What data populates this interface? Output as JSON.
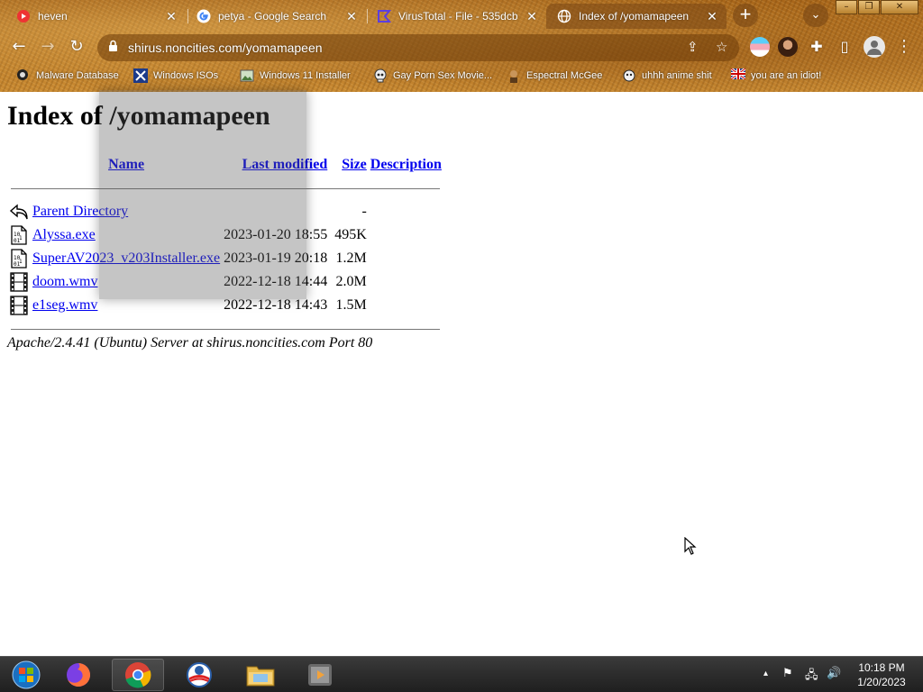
{
  "browser": {
    "tabs": [
      {
        "title": "heven",
        "icon": "youtube-red-icon",
        "active": false
      },
      {
        "title": "petya - Google Search",
        "icon": "google-g-icon",
        "active": false
      },
      {
        "title": "VirusTotal - File - 535dcb",
        "icon": "virustotal-icon",
        "active": false
      },
      {
        "title": "Index of /yomamapeen",
        "icon": "globe-icon",
        "active": true
      }
    ],
    "tab_close_glyph": "✕",
    "new_tab_glyph": "+",
    "tab_search_glyph": "⌄",
    "window_controls": {
      "minimize": "–",
      "maximize": "❐",
      "close": "✕"
    },
    "nav": {
      "back": "←",
      "forward": "→",
      "reload": "↻"
    },
    "address": {
      "url": "shirus.noncities.com/yomamapeen",
      "lock": "🔒",
      "share": "⇪",
      "star": "☆"
    },
    "toolbar_right": {
      "extensions": "✚",
      "sidepanel": "▯",
      "profile": "●",
      "menu": "⋮"
    },
    "bookmarks": [
      {
        "label": "Malware Database",
        "icon": "ball-icon"
      },
      {
        "label": "Windows ISOs",
        "icon": "x-logo-icon"
      },
      {
        "label": "Windows 11 Installer",
        "icon": "image-icon"
      },
      {
        "label": "Gay Porn Sex Movie...",
        "icon": "skull-icon"
      },
      {
        "label": "Espectral McGee",
        "icon": "character-icon"
      },
      {
        "label": "uhhh anime shit",
        "icon": "character-icon"
      },
      {
        "label": "you are an idiot!",
        "icon": "flag-icon"
      }
    ]
  },
  "page": {
    "title": "Index of /yomamapeen",
    "columns": {
      "name": "Name",
      "modified": "Last modified",
      "size": "Size",
      "description": "Description"
    },
    "rows": [
      {
        "icon": "back-arrow-icon",
        "name": "Parent Directory",
        "modified": "",
        "size": "-",
        "description": ""
      },
      {
        "icon": "binary-file-icon",
        "name": "Alyssa.exe",
        "modified": "2023-01-20 18:55",
        "size": "495K",
        "description": ""
      },
      {
        "icon": "binary-file-icon",
        "name": "SuperAV2023_v203Installer.exe",
        "modified": "2023-01-19 20:18",
        "size": "1.2M",
        "description": ""
      },
      {
        "icon": "film-icon",
        "name": "doom.wmv",
        "modified": "2022-12-18 14:44",
        "size": "2.0M",
        "description": ""
      },
      {
        "icon": "film-icon",
        "name": "e1seg.wmv",
        "modified": "2022-12-18 14:43",
        "size": "1.5M",
        "description": ""
      }
    ],
    "footer": "Apache/2.4.41 (Ubuntu) Server at shirus.noncities.com Port 80"
  },
  "taskbar": {
    "items": [
      "start-orb-icon",
      "firefox-icon",
      "chrome-icon",
      "obama-logo-icon",
      "file-explorer-icon",
      "media-player-icon"
    ],
    "clock": {
      "time": "10:18 PM",
      "date": "1/20/2023"
    },
    "tray": {
      "up": "▴",
      "flag": "⚑",
      "network": "🖧",
      "volume": "🔊"
    }
  },
  "colors": {
    "link": "#0000ee",
    "chrome_base": "#b97825",
    "taskbar": "#2a2a2a"
  }
}
